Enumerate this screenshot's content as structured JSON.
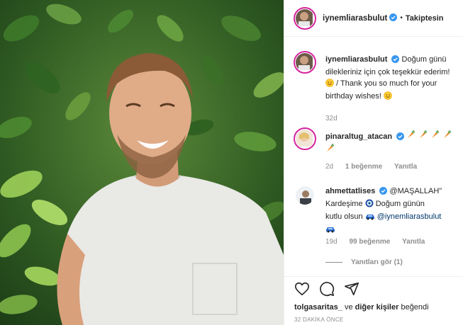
{
  "post": {
    "username": "iynemliarasbulut",
    "follow_status": "Takiptesin",
    "caption_line1": "Doğum günü",
    "caption_line2": "dilekleriniz için çok teşekkür ederim!",
    "caption_line3": "/ Thank you so much for your",
    "caption_line4": "birthday wishes!",
    "caption_age": "32d"
  },
  "comments": [
    {
      "username": "pinaraltug_atacan",
      "age": "2d",
      "likes": "1 beğenme",
      "reply": "Yanıtla"
    },
    {
      "username": "ahmettatlises",
      "mention_inline": "@MAŞALLAH\"",
      "text_line2": "Kardeşime",
      "text_line2b": "Doğum günün",
      "text_line3": "kutlu olsun",
      "mention_end": "@iynemliarasbulut",
      "age": "19d",
      "likes": "99 beğenme",
      "reply": "Yanıtla"
    }
  ],
  "view_replies": "Yanıtları gör (1)",
  "likes_line": {
    "user": "tolgasaritas_",
    "middle": "ve",
    "others": "diğer kişiler",
    "end": "beğendi"
  },
  "timestamp": "32 DAKİKA ÖNCE",
  "icons": [
    "heart-icon",
    "comment-icon",
    "share-icon",
    "verified-icon"
  ],
  "colors": {
    "verified": "#3897f0",
    "muted": "#8e8e8e",
    "link": "#00376b",
    "story_ring": "#d6249f"
  }
}
